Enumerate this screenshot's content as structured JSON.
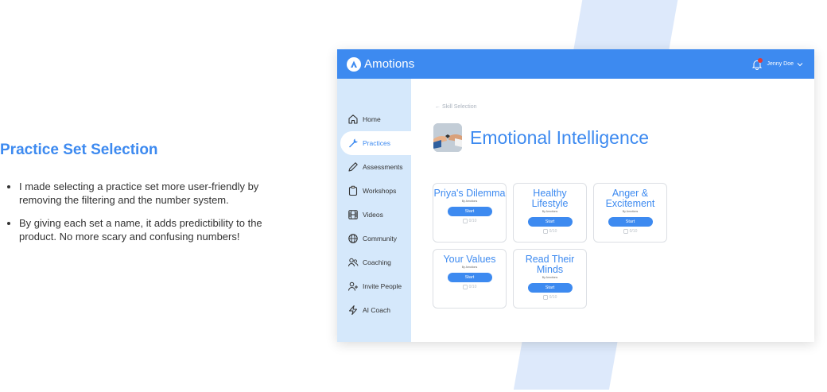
{
  "description": {
    "heading": "Practice Set Selection",
    "bullets": [
      "I made selecting a practice set more user-friendly by removing the filtering and the number system.",
      "By giving each set a name, it adds predictibility to the product. No more scary and confusing numbers!"
    ]
  },
  "app": {
    "brand": "Amotions",
    "user_name": "Jenny Doe",
    "colors": {
      "accent": "#3d8af0",
      "sidebar": "#d5e8fb",
      "notification": "#e53935"
    },
    "sidebar": {
      "items": [
        {
          "label": "Home",
          "icon": "home-icon"
        },
        {
          "label": "Practices",
          "icon": "wrench-icon",
          "active": true
        },
        {
          "label": "Assessments",
          "icon": "pencil-icon"
        },
        {
          "label": "Workshops",
          "icon": "clipboard-icon"
        },
        {
          "label": "Videos",
          "icon": "film-icon"
        },
        {
          "label": "Community",
          "icon": "globe-icon"
        },
        {
          "label": "Coaching",
          "icon": "users-icon"
        },
        {
          "label": "Invite People",
          "icon": "user-plus-icon"
        },
        {
          "label": "AI Coach",
          "icon": "lightning-icon"
        }
      ]
    },
    "main": {
      "breadcrumb": "← Skill Selection",
      "title": "Emotional Intelligence",
      "cards": [
        {
          "title": "Priya's Dilemma",
          "by": "By Amotions",
          "button": "Start",
          "progress": "0/10"
        },
        {
          "title": "Healthy Lifestyle",
          "by": "By Amotions",
          "button": "Start",
          "progress": "0/10"
        },
        {
          "title": "Anger & Excitement",
          "by": "By Amotions",
          "button": "Start",
          "progress": "0/10"
        },
        {
          "title": "Your Values",
          "by": "By Amotions",
          "button": "Start",
          "progress": "0/10"
        },
        {
          "title": "Read Their Minds",
          "by": "By Amotions",
          "button": "Start",
          "progress": "0/10"
        }
      ]
    }
  }
}
